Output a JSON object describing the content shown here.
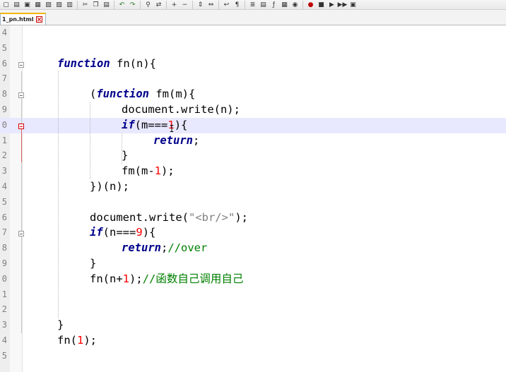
{
  "toolbar": {
    "buttons": [
      {
        "name": "new-file-icon",
        "glyph": "▢"
      },
      {
        "name": "open-file-icon",
        "glyph": "▤"
      },
      {
        "name": "save-icon",
        "glyph": "▣"
      },
      {
        "name": "save-all-icon",
        "glyph": "▦"
      },
      {
        "name": "close-icon",
        "glyph": "▨"
      },
      {
        "name": "close-all-icon",
        "glyph": "▧"
      },
      {
        "name": "print-icon",
        "glyph": "▥"
      },
      {
        "name": "cut-icon",
        "glyph": "✂"
      },
      {
        "name": "copy-icon",
        "glyph": "❐"
      },
      {
        "name": "paste-icon",
        "glyph": "▤"
      },
      {
        "name": "undo-icon",
        "glyph": "↶"
      },
      {
        "name": "redo-icon",
        "glyph": "↷"
      },
      {
        "name": "find-icon",
        "glyph": "⚲"
      },
      {
        "name": "replace-icon",
        "glyph": "⇄"
      },
      {
        "name": "zoom-in-icon",
        "glyph": "+"
      },
      {
        "name": "zoom-out-icon",
        "glyph": "−"
      },
      {
        "name": "sync-vertical-icon",
        "glyph": "⇕"
      },
      {
        "name": "sync-horizontal-icon",
        "glyph": "⇔"
      },
      {
        "name": "word-wrap-icon",
        "glyph": "↩"
      },
      {
        "name": "show-all-chars-icon",
        "glyph": "¶"
      },
      {
        "name": "indent-guide-icon",
        "glyph": "≣"
      },
      {
        "name": "doc-map-icon",
        "glyph": "▤"
      },
      {
        "name": "function-list-icon",
        "glyph": "ƒ"
      },
      {
        "name": "folder-workspace-icon",
        "glyph": "▦"
      },
      {
        "name": "monitoring-icon",
        "glyph": "◉"
      },
      {
        "name": "record-macro-icon",
        "glyph": "●"
      },
      {
        "name": "stop-macro-icon",
        "glyph": "■"
      },
      {
        "name": "play-macro-icon",
        "glyph": "▶"
      },
      {
        "name": "play-multiple-macro-icon",
        "glyph": "▶▶"
      },
      {
        "name": "save-macro-icon",
        "glyph": "▣"
      }
    ]
  },
  "tab": {
    "label": "1_pn.html"
  },
  "colors": {
    "keyword": "#00008b",
    "number": "#ff0000",
    "string": "#808080",
    "comment": "#008000",
    "current_line": "#e8e8ff",
    "gutter": "#eeeeee"
  },
  "editor": {
    "lines": [
      {
        "num": "4"
      },
      {
        "num": "5"
      },
      {
        "num": "6"
      },
      {
        "num": "7"
      },
      {
        "num": "8"
      },
      {
        "num": "9"
      },
      {
        "num": "0"
      },
      {
        "num": "1"
      },
      {
        "num": "2"
      },
      {
        "num": "3"
      },
      {
        "num": "4"
      },
      {
        "num": "5"
      },
      {
        "num": "6"
      },
      {
        "num": "7"
      },
      {
        "num": "8"
      },
      {
        "num": "9"
      },
      {
        "num": "0"
      },
      {
        "num": "1"
      },
      {
        "num": "2"
      },
      {
        "num": "3"
      },
      {
        "num": "4"
      },
      {
        "num": "5"
      }
    ],
    "code": {
      "l6_kw": "function",
      "l6_rest": " fn(n){",
      "l8_open": "(",
      "l8_kw": "function",
      "l8_rest": " fm(m){",
      "l9": "document.write(n);",
      "l10_kw": "if",
      "l10_a": "(m==",
      "l10_b": "=",
      "l10_num": "1",
      "l10_c": "){",
      "l11_kw": "return",
      "l11_rest": ";",
      "l12": "}",
      "l13_a": "fm(m-",
      "l13_num": "1",
      "l13_b": ");",
      "l14": "})(n);",
      "l16_a": "document.write(",
      "l16_str": "\"<br/>\"",
      "l16_b": ");",
      "l17_kw": "if",
      "l17_a": "(n===",
      "l17_num": "9",
      "l17_b": "){",
      "l18_kw": "return",
      "l18_a": ";",
      "l18_cm": "//over",
      "l19": "}",
      "l20_a": "fn(n+",
      "l20_num": "1",
      "l20_b": ");",
      "l20_cm": "//函数自己调用自己",
      "l23": "}",
      "l24_a": "fn(",
      "l24_num": "1",
      "l24_b": ");"
    }
  }
}
